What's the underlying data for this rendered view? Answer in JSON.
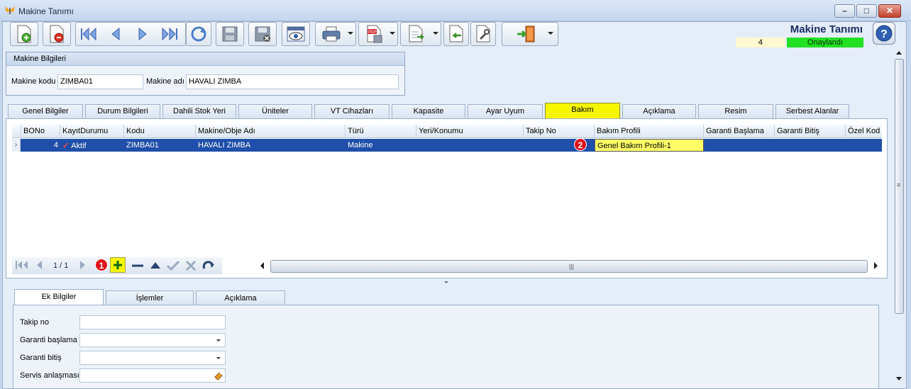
{
  "window": {
    "title": "Makine Tanımı",
    "controls": [
      "minimize",
      "maximize",
      "close"
    ]
  },
  "toolbar": {
    "buttons": [
      {
        "name": "new-icon"
      },
      {
        "name": "delete-icon"
      },
      {
        "name": "first-record-icon"
      },
      {
        "name": "previous-record-icon"
      },
      {
        "name": "next-record-icon"
      },
      {
        "name": "last-record-icon"
      },
      {
        "name": "refresh-icon"
      },
      {
        "name": "save-icon"
      },
      {
        "name": "save-cancel-icon"
      },
      {
        "name": "preview-icon"
      },
      {
        "name": "print-icon"
      },
      {
        "name": "pdf-export-icon"
      },
      {
        "name": "export-icon"
      },
      {
        "name": "import-icon"
      },
      {
        "name": "tools-icon"
      },
      {
        "name": "exit-icon"
      }
    ]
  },
  "header": {
    "title": "Makine Tanımı",
    "record_number": "4",
    "status": "Onaylandı",
    "status_color": "#22e022"
  },
  "machine_info": {
    "group_title": "Makine Bilgileri",
    "code_label": "Makine kodu",
    "code_value": "ZIMBA01",
    "name_label": "Makine adı",
    "name_value": "HAVALI ZIMBA"
  },
  "tabs": [
    {
      "label": "Genel Bilgiler"
    },
    {
      "label": "Durum Bilgileri"
    },
    {
      "label": "Dahili Stok Yeri"
    },
    {
      "label": "Üniteler"
    },
    {
      "label": "VT Cihazları"
    },
    {
      "label": "Kapasite"
    },
    {
      "label": "Ayar Uyum"
    },
    {
      "label": "Bakım"
    },
    {
      "label": "Açıklama"
    },
    {
      "label": "Resim"
    },
    {
      "label": "Serbest Alanlar"
    }
  ],
  "active_tab_color": "#f6f600",
  "grid": {
    "columns": [
      "BONo",
      "KayıtDurumu",
      "Kodu",
      "Makine/Obje Adı",
      "Türü",
      "Yeri/Konumu",
      "Takip No",
      "Bakım Profili",
      "Garanti Başlama",
      "Garanti Bitiş",
      "Özel Kod"
    ],
    "rows": [
      {
        "bono": "4",
        "kayit_durumu": "Aktif",
        "kodu": "ZIMBA01",
        "makine_adi": "HAVALI ZIMBA",
        "turu": "Makine",
        "yeri": "",
        "takip_no": "",
        "bakim_profili": "Genel Bakım Profili-1",
        "garanti_baslama": "",
        "garanti_bitis": "",
        "ozel_kod": ""
      }
    ],
    "pager": "1 / 1",
    "badge_1": "1",
    "badge_2": "2"
  },
  "bottom_tabs": [
    {
      "label": "Ek Bilgiler"
    },
    {
      "label": "İşlemler"
    },
    {
      "label": "Açıklama"
    }
  ],
  "extra_info": {
    "takip_no_label": "Takip no",
    "garanti_baslama_label": "Garanti başlama",
    "garanti_bitis_label": "Garanti bitiş",
    "servis_label": "Servis anlaşması"
  }
}
